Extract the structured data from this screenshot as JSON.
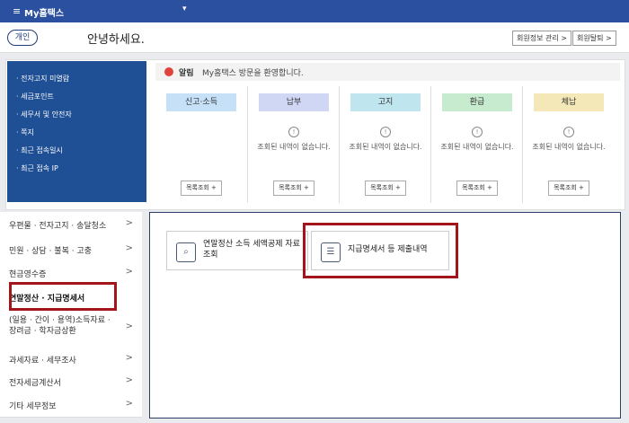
{
  "topbar": {
    "menu_icon": "≡",
    "title": "My홈택스",
    "chevron": "▾"
  },
  "header": {
    "tab_label": "개인",
    "greeting": "안녕하세요.",
    "member_info_btn": "회원정보 관리 >",
    "withdraw_btn": "회원탈퇴 >"
  },
  "quick_links": [
    "· 전자고지 미열람",
    "· 세금포인트",
    "· 세무서 및 안전자",
    "· 쪽지",
    "· 최근 접속일시",
    "· 최근 접속 IP"
  ],
  "alert": {
    "label": "알림",
    "message": "My홈택스 방문을 환영합니다."
  },
  "columns": [
    {
      "tag": "신고·소득",
      "color": "#c6e0f7",
      "show_none": false,
      "btn": "목록조회 +"
    },
    {
      "tag": "납부",
      "color": "#cfd7f4",
      "show_none": true,
      "none_text": "조회된 내역이 없습니다.",
      "btn": "목록조회 +"
    },
    {
      "tag": "고지",
      "color": "#bfe6ef",
      "show_none": true,
      "none_text": "조회된 내역이 없습니다.",
      "btn": "목록조회 +"
    },
    {
      "tag": "환급",
      "color": "#c7ebcf",
      "show_none": true,
      "none_text": "조회된 내역이 없습니다.",
      "btn": "목록조회 +"
    },
    {
      "tag": "체납",
      "color": "#f4e8b9",
      "show_none": true,
      "none_text": "조회된 내역이 없습니다.",
      "btn": "목록조회 +"
    }
  ],
  "side_menu": [
    {
      "label": "우편물 · 전자고지 · 송달청소",
      "arrow": ">"
    },
    {
      "label": "민원 · 상담 · 불복 · 고충",
      "arrow": ">"
    },
    {
      "label": "현금영수증",
      "arrow": ">"
    },
    {
      "label": "연말정산 · 지급명세서",
      "arrow": "",
      "active": true
    },
    {
      "label": "(일용 · 간이 · 용역)소득자료 · 장려금 · 학자금상환",
      "arrow": ">"
    },
    {
      "label": "과세자료 · 세무조사",
      "arrow": ">"
    },
    {
      "label": "전자세금계산서",
      "arrow": ">"
    },
    {
      "label": "기타 세무정보",
      "arrow": ">"
    }
  ],
  "cards": [
    {
      "title": "연말정산 소득 세액공제 자료 조회",
      "icon": "search-doc-icon"
    },
    {
      "title": "지급명세서 등 제출내역",
      "icon": "doc-list-icon"
    }
  ],
  "highlight_color": "#a3141b"
}
